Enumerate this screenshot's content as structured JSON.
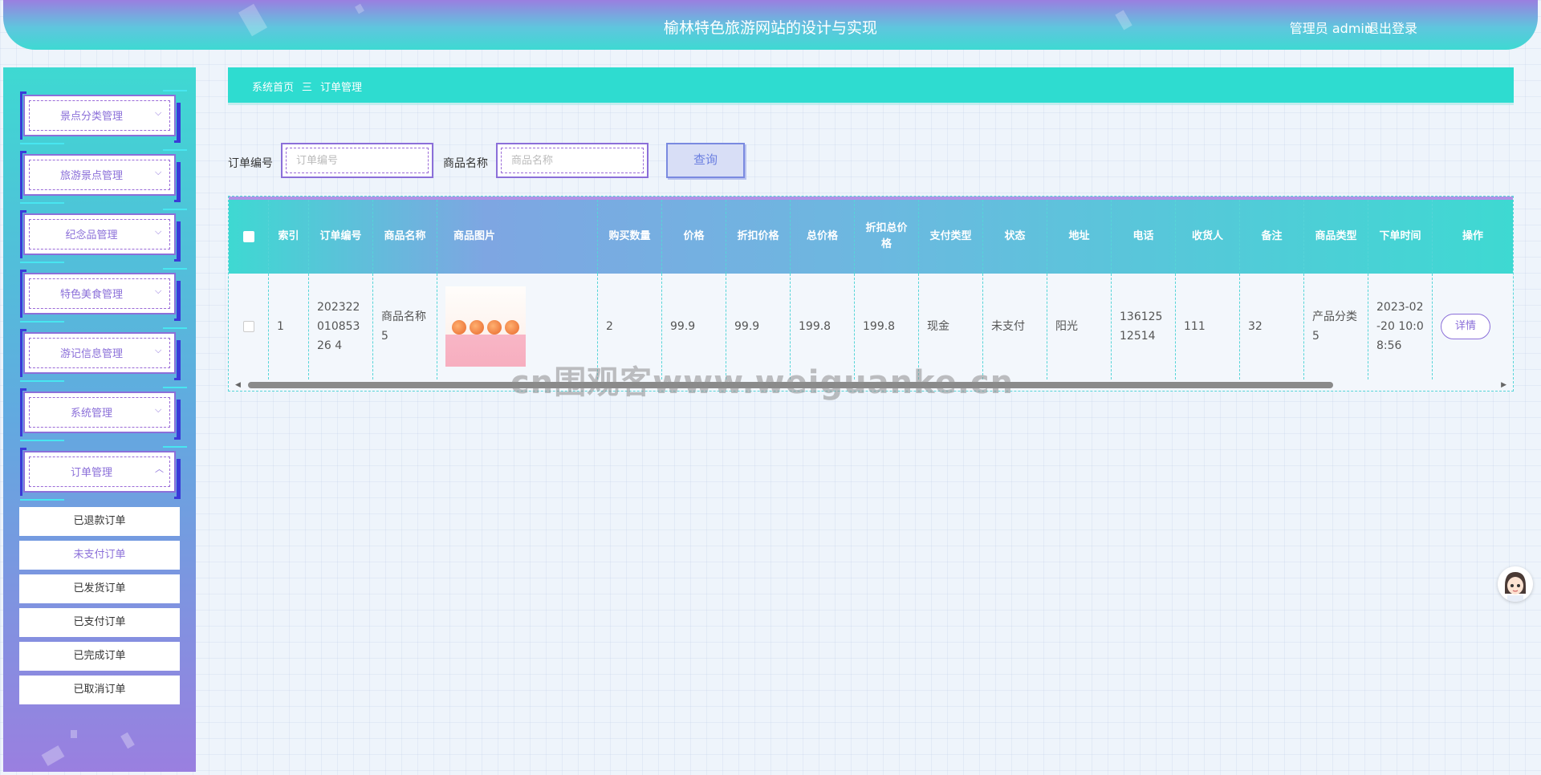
{
  "header": {
    "title": "榆林特色旅游网站的设计与实现",
    "user": "管理员 admin",
    "logout": "退出登录"
  },
  "sidebar": {
    "menus": [
      {
        "label": "景点分类管理",
        "expanded": false
      },
      {
        "label": "旅游景点管理",
        "expanded": false
      },
      {
        "label": "纪念品管理",
        "expanded": false
      },
      {
        "label": "特色美食管理",
        "expanded": false
      },
      {
        "label": "游记信息管理",
        "expanded": false
      },
      {
        "label": "系统管理",
        "expanded": false
      },
      {
        "label": "订单管理",
        "expanded": true
      }
    ],
    "submenu": [
      {
        "label": "已退款订单",
        "active": false
      },
      {
        "label": "未支付订单",
        "active": true
      },
      {
        "label": "已发货订单",
        "active": false
      },
      {
        "label": "已支付订单",
        "active": false
      },
      {
        "label": "已完成订单",
        "active": false
      },
      {
        "label": "已取消订单",
        "active": false
      }
    ]
  },
  "breadcrumb": {
    "home": "系统首页",
    "separator": "三",
    "current": "订单管理"
  },
  "search": {
    "order_no_label": "订单编号",
    "order_no_placeholder": "订单编号",
    "product_name_label": "商品名称",
    "product_name_placeholder": "商品名称",
    "query_button": "查询"
  },
  "table": {
    "headers": [
      "索引",
      "订单编号",
      "商品名称",
      "商品图片",
      "购买数量",
      "价格",
      "折扣价格",
      "总价格",
      "折扣总价格",
      "支付类型",
      "状态",
      "地址",
      "电话",
      "收货人",
      "备注",
      "商品类型",
      "下单时间",
      "操作"
    ],
    "rows": [
      {
        "index": "1",
        "order_no": "20232201085326 4",
        "product_name": "商品名称5",
        "quantity": "2",
        "price": "99.9",
        "discount_price": "99.9",
        "total": "199.8",
        "discount_total": "199.8",
        "pay_type": "现金",
        "status": "未支付",
        "address": "阳光",
        "phone": "13612512514",
        "receiver": "111",
        "remark": "32",
        "product_type": "产品分类5",
        "order_time": "2023-02-20 10:08:56",
        "action": "详情"
      }
    ]
  },
  "watermark": "cn围观客www.weiguanke.cn",
  "colors": {
    "accent_purple": "#8b6fd9",
    "teal": "#2edcd0",
    "deep_blue": "#3a3ad8"
  }
}
